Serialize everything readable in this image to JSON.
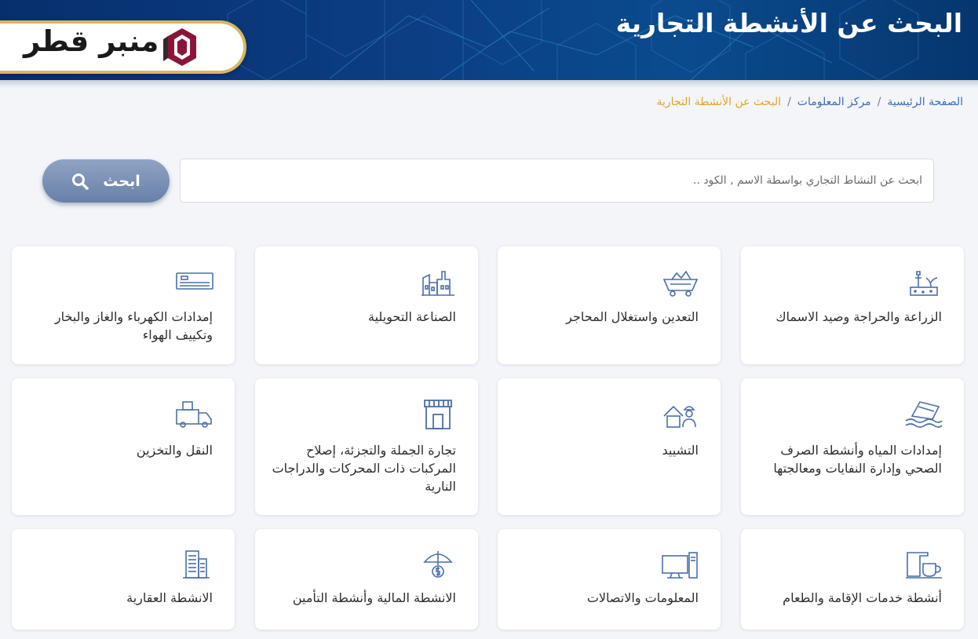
{
  "header": {
    "title": "البحث عن الأنشطة التجارية",
    "logo_text": "منبر قطر"
  },
  "breadcrumb": {
    "home": "الصفحة الرئيسية",
    "separator": "/",
    "info_center": "مركز المعلومات",
    "current": "البحث عن الأنشطة التجارية"
  },
  "search": {
    "placeholder": "ابحث عن النشاط التجاري بواسطة الاسم , الكود ..",
    "value": "",
    "button_label": "ابحث"
  },
  "colors": {
    "header": "#0c3f85",
    "accent_gold": "#d8b75d",
    "link": "#3d6db4",
    "breadcrumb_active": "#e0a52a",
    "button": "#7990b6",
    "icon": "#4a6fa8"
  },
  "categories": [
    {
      "label": "الزراعة والحراجة وصيد الاسماك",
      "icon": "agriculture-icon"
    },
    {
      "label": "التعدين واستغلال المحاجر",
      "icon": "mining-cart-icon"
    },
    {
      "label": "الصناعة التحويلية",
      "icon": "factory-icon"
    },
    {
      "label": "إمدادات الكهرباء والغاز والبخار وتكييف الهواء",
      "icon": "air-conditioner-icon"
    },
    {
      "label": "إمدادات المياه وأنشطة الصرف الصحي وإدارة النفايات ومعالجتها",
      "icon": "water-waste-icon"
    },
    {
      "label": "التشييد",
      "icon": "construction-worker-icon"
    },
    {
      "label": "تجارة الجملة والتجزئة، إصلاح المركبات ذات المحركات والدراجات النارية",
      "icon": "store-icon"
    },
    {
      "label": "النقل والتخزين",
      "icon": "truck-icon"
    },
    {
      "label": "أنشطة خدمات الإقامة والطعام",
      "icon": "coffee-cup-icon"
    },
    {
      "label": "المعلومات والاتصالات",
      "icon": "computer-icon"
    },
    {
      "label": "الانشطة المالية وأنشطة التأمين",
      "icon": "umbrella-money-icon"
    },
    {
      "label": "الانشطة العقارية",
      "icon": "buildings-icon"
    }
  ]
}
